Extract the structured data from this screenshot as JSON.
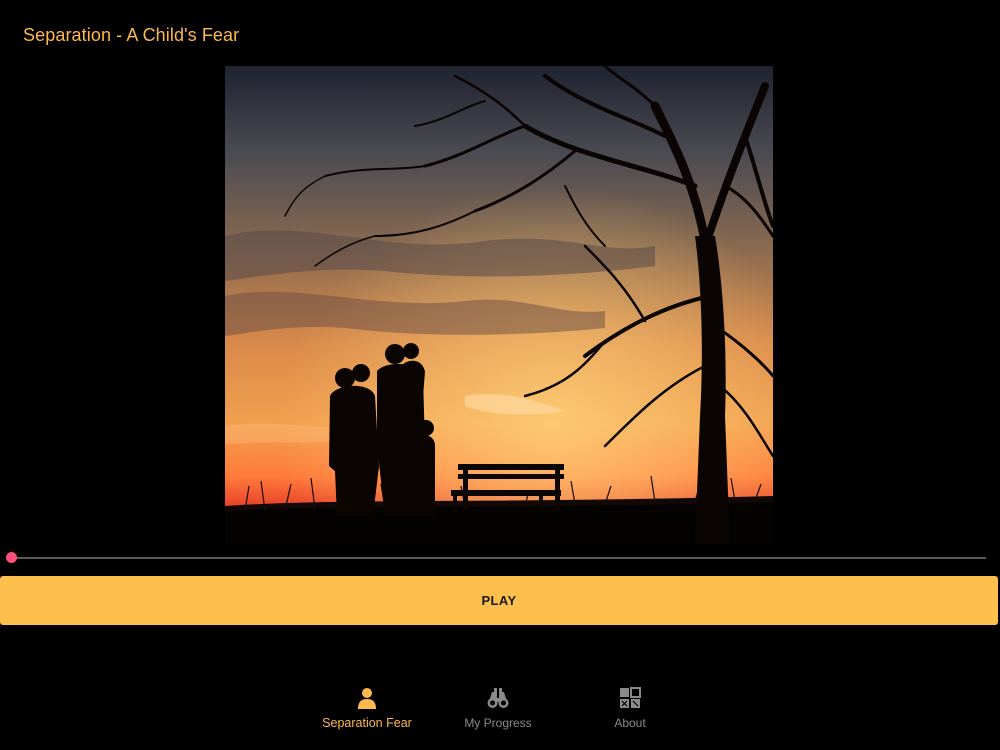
{
  "header": {
    "title": "Separation - A Child's Fear"
  },
  "player": {
    "progress_fraction": 0.0,
    "play_label": "PLAY"
  },
  "bottom_nav": {
    "items": [
      {
        "label": "Separation Fear",
        "icon": "person-icon",
        "active": true
      },
      {
        "label": "My Progress",
        "icon": "binoculars-icon",
        "active": false
      },
      {
        "label": "About",
        "icon": "grid-icon",
        "active": false
      }
    ]
  },
  "colors": {
    "accent": "#ffb84d",
    "button": "#ffbf4d",
    "seek": "#ff4f7b",
    "inactive": "#8a8a8a",
    "background": "#000000"
  }
}
